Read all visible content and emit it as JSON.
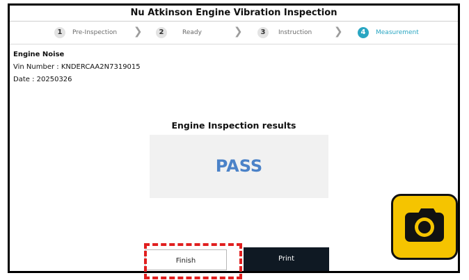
{
  "app": {
    "title": "Nu Atkinson Engine Vibration Inspection"
  },
  "steps": [
    {
      "num": "1",
      "label": "Pre-Inspection",
      "active": false
    },
    {
      "num": "2",
      "label": "Ready",
      "active": false
    },
    {
      "num": "3",
      "label": "Instruction",
      "active": false
    },
    {
      "num": "4",
      "label": "Measurement",
      "active": true
    }
  ],
  "info": {
    "heading": "Engine Noise",
    "vin": "Vin Number : KNDERCAA2N7319015",
    "date": "Date : 20250326"
  },
  "results": {
    "title": "Engine Inspection results",
    "status": "PASS"
  },
  "buttons": {
    "finish": "Finish",
    "print": "Print"
  },
  "colors": {
    "accent": "#2aa6c2",
    "pass": "#4b82c8",
    "highlight": "#e11f1f",
    "print_bg": "#0f1923",
    "camera": "#f5c400"
  },
  "icons": {
    "camera": "camera-icon",
    "chevron": "chevron-right-icon"
  }
}
